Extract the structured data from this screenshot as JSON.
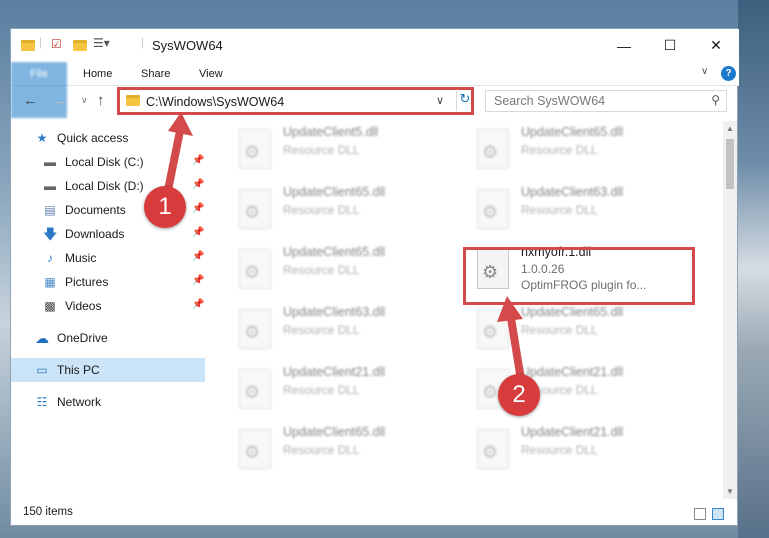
{
  "window": {
    "title": "SysWOW64",
    "minimize": "—",
    "maximize": "☐",
    "close": "✕"
  },
  "ribbon": {
    "tabs": [
      "File",
      "Home",
      "Share",
      "View"
    ],
    "help": "?",
    "chevron": "∨"
  },
  "nav": {
    "back": "←",
    "forward": "→",
    "recent": "∨",
    "up": "↑",
    "address": "C:\\Windows\\SysWOW64",
    "search_placeholder": "Search SysWOW64",
    "refresh": "↻"
  },
  "sidebar": {
    "items": [
      {
        "label": "Quick access",
        "icon": "star-icon"
      },
      {
        "label": "Local Disk (C:)",
        "icon": "drive-icon",
        "pinned": true
      },
      {
        "label": "Local Disk (D:)",
        "icon": "drive-icon",
        "pinned": true
      },
      {
        "label": "Documents",
        "icon": "documents-icon",
        "pinned": true
      },
      {
        "label": "Downloads",
        "icon": "downloads-icon",
        "pinned": true
      },
      {
        "label": "Music",
        "icon": "music-icon",
        "pinned": true
      },
      {
        "label": "Pictures",
        "icon": "pictures-icon",
        "pinned": true
      },
      {
        "label": "Videos",
        "icon": "videos-icon",
        "pinned": true
      },
      {
        "label": "OneDrive",
        "icon": "cloud-icon"
      },
      {
        "label": "This PC",
        "icon": "computer-icon",
        "selected": true
      },
      {
        "label": "Network",
        "icon": "network-icon"
      }
    ]
  },
  "files": [
    {
      "name": "UpdateClient5.dll",
      "type": "Resource DLL"
    },
    {
      "name": "UpdateClient65.dll",
      "type": "Resource DLL"
    },
    {
      "name": "UpdateClient65.dll",
      "type": "Resource DLL"
    },
    {
      "name": "UpdateClient63.dll",
      "type": "Resource DLL"
    },
    {
      "name": "UpdateClient65.dll",
      "type": "Resource DLL"
    },
    {
      "name": "nxmyofr.1.dll",
      "version": "1.0.0.26",
      "description": "OptimFROG plugin fo..."
    },
    {
      "name": "UpdateClient63.dll",
      "type": "Resource DLL"
    },
    {
      "name": "UpdateClient65.dll",
      "type": "Resource DLL"
    },
    {
      "name": "UpdateClient21.dll",
      "type": "Resource DLL"
    },
    {
      "name": "UpdateClient21.dll",
      "type": "Resource DLL"
    },
    {
      "name": "UpdateClient65.dll",
      "type": "Resource DLL"
    },
    {
      "name": "UpdateClient21.dll",
      "type": "Resource DLL"
    }
  ],
  "status": {
    "count": "150 items"
  },
  "annotations": {
    "marker1": "1",
    "marker2": "2",
    "color": "#d44a4a"
  }
}
